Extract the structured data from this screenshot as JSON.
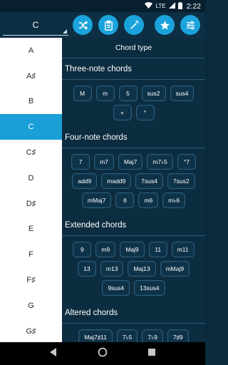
{
  "status": {
    "time": "2:22",
    "network": "LTE"
  },
  "toolbar": {
    "key_value": "C",
    "buttons": [
      "shuffle-icon",
      "clipboard-icon",
      "magic-wand-icon",
      "star-icon",
      "sliders-icon"
    ]
  },
  "keys": [
    "A",
    "A♯",
    "B",
    "C",
    "C♯",
    "D",
    "D♯",
    "E",
    "F",
    "F♯",
    "G",
    "G♯"
  ],
  "active_key": "C",
  "panel": {
    "header": "Chord type",
    "sections": [
      {
        "title": "Three-note chords",
        "rows": [
          [
            "M",
            "m",
            "5",
            "sus2",
            "sus4"
          ],
          [
            "+",
            "°"
          ]
        ]
      },
      {
        "title": "Four-note chords",
        "rows": [
          [
            "7",
            "m7",
            "Maj7",
            "m7♭5",
            "°7"
          ],
          [
            "add9",
            "madd9",
            "7sus4",
            "7sus2"
          ],
          [
            "mMaj7",
            "6",
            "m6",
            "m♭6"
          ]
        ]
      },
      {
        "title": "Extended chords",
        "rows": [
          [
            "9",
            "m9",
            "Maj9",
            "11",
            "m11"
          ],
          [
            "13",
            "m13",
            "Maj13",
            "mMaj9"
          ],
          [
            "9sus4",
            "13sus4"
          ]
        ]
      },
      {
        "title": "Altered chords",
        "rows": [
          [
            "Maj7♯11",
            "7♭5",
            "7♭9",
            "7♯9"
          ]
        ]
      }
    ]
  },
  "colors": {
    "accent": "#1aa3dc",
    "background": "#0c2c40",
    "list_bg": "#ffffff"
  }
}
